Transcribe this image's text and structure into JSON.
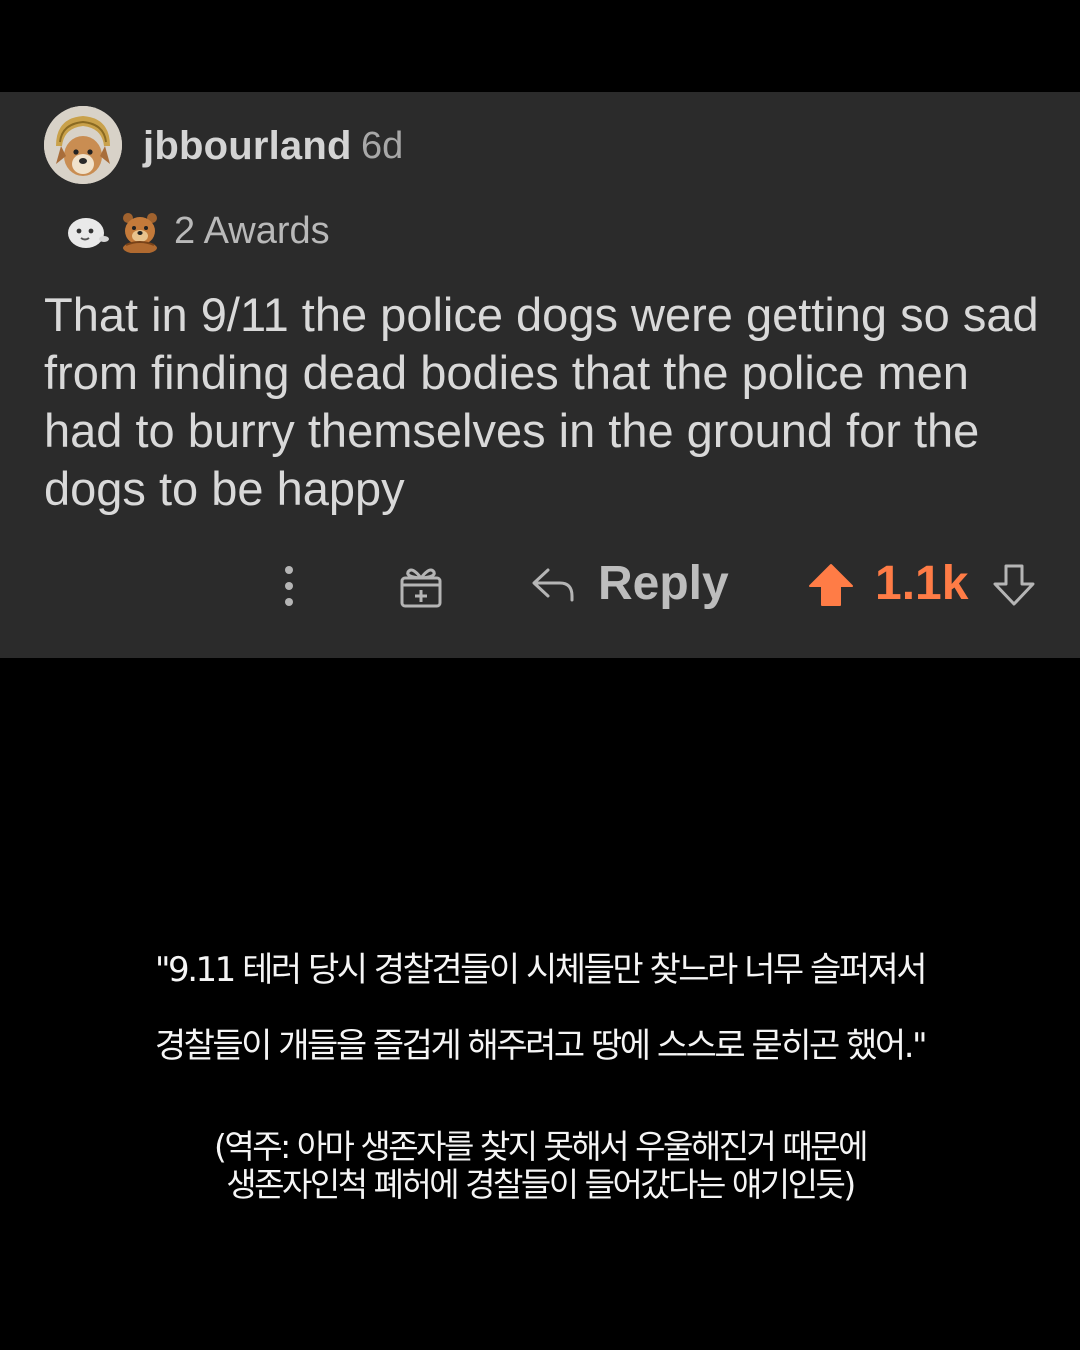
{
  "comment": {
    "username": "jbbourland",
    "age": "6d",
    "awards": {
      "icons": [
        "seal-award-icon",
        "bear-award-icon"
      ],
      "label": "2 Awards"
    },
    "body": "That in 9/11 the police dogs were getting so sad from finding dead bodies that the police men had to burry themselves in the ground for the dogs to be happy",
    "actions": {
      "more_icon": "vertical-dots-icon",
      "gift_icon": "gift-icon",
      "reply_icon": "reply-arrow-icon",
      "reply_label": "Reply",
      "upvote_icon": "upvote-arrow-icon",
      "vote_count": "1.1k",
      "downvote_icon": "downvote-arrow-icon"
    },
    "colors": {
      "card_background": "#2b2b2b",
      "upvote_accent": "#ff7c46"
    }
  },
  "translation": {
    "line_1": "\"9.11 테러 당시 경찰견들이 시체들만 찾느라 너무 슬퍼져서",
    "line_2": "경찰들이 개들을 즐겁게 해주려고 땅에 스스로 묻히곤 했어.\"",
    "note_line_1": "(역주: 아마 생존자를 찾지 못해서 우울해진거 때문에",
    "note_line_2": "생존자인척 폐허에 경찰들이 들어갔다는 얘기인듯)"
  }
}
